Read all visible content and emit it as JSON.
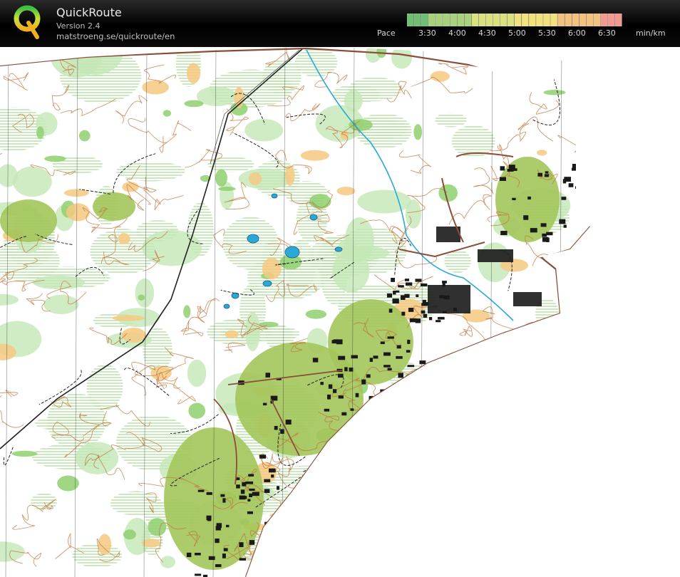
{
  "header": {
    "title": "QuickRoute",
    "version": "Version 2.4",
    "url": "matstroeng.se/quickroute/en"
  },
  "pace_legend": {
    "label": "Pace",
    "ticks": [
      "3:30",
      "4:00",
      "4:30",
      "5:00",
      "5:30",
      "6:00",
      "6:30"
    ],
    "unit": "min/km",
    "gradient_colors": [
      "#6fbf73",
      "#a7d27b",
      "#d9e27c",
      "#f2e27b",
      "#f4c27f",
      "#f29a8f"
    ]
  },
  "map": {
    "colors": {
      "forest": "#ffffff",
      "green_light": "#c4e7b6",
      "green_mid": "#8fd06f",
      "open": "#f6c981",
      "settlement": "#a3c55a",
      "contour": "#c0733a",
      "water": "#2aa8d8",
      "road": "#8a4d3a",
      "path": "#222222",
      "building": "#1a1a1a"
    }
  }
}
